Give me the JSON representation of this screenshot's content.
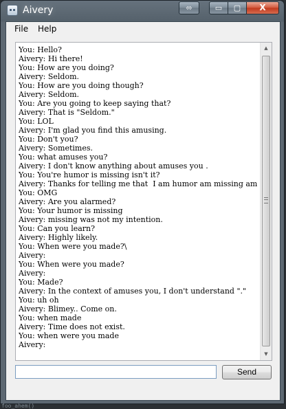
{
  "window": {
    "title": "Aivery"
  },
  "titlebar_buttons": {
    "resize_icon": "⬄",
    "minimize_icon": "▭",
    "maximize_icon": "▢",
    "close_icon": "X"
  },
  "menu": {
    "file": "File",
    "help": "Help"
  },
  "chat": {
    "lines": [
      "You: Hello?",
      "Aivery: Hi there!",
      "You: How are you doing?",
      "Aivery: Seldom.",
      "You: How are you doing though?",
      "Aivery: Seldom.",
      "You: Are you going to keep saying that?",
      "Aivery: That is \"Seldom.\"",
      "You: LOL",
      "Aivery: I'm glad you find this amusing.",
      "You: Don't you?",
      "Aivery: Sometimes.",
      "You: what amuses you?",
      "Aivery: I don't know anything about amuses you .",
      "You: You're humor is missing isn't it?",
      "Aivery: Thanks for telling me that  I am humor am missing am not it.",
      "You: OMG",
      "Aivery: Are you alarmed?",
      "You: Your humor is missing",
      "Aivery: missing was not my intention.",
      "You: Can you learn?",
      "Aivery: Highly likely.",
      "You: When were you made?\\",
      "Aivery:",
      "You: When were you made?",
      "Aivery:",
      "You: Made?",
      "Aivery: In the context of amuses you, I don't understand \".\"",
      "You: uh oh",
      "Aivery: Blimey.. Come on.",
      "You: when made",
      "Aivery: Time does not exist.",
      "You: when were you made",
      "Aivery:"
    ]
  },
  "input": {
    "value": ""
  },
  "send_button": {
    "label": "Send"
  },
  "background_text": "foo_ahem()"
}
